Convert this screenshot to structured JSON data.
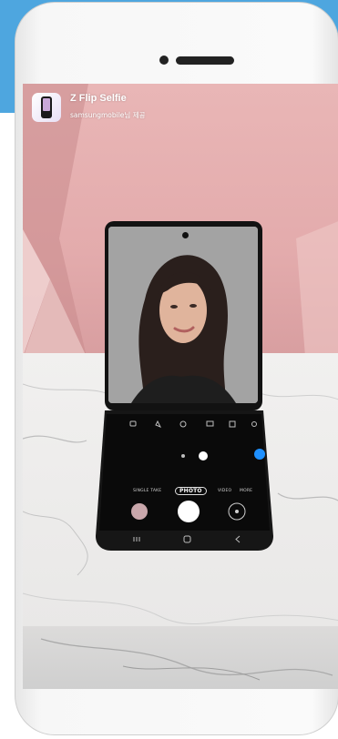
{
  "app": {
    "title": "Z Flip Selfie",
    "subtitle": "samsungmobile님 제공",
    "icon": "app-phone-icon"
  },
  "camera": {
    "modes": [
      "SINGLE TAKE",
      "PHOTO",
      "VIDEO",
      "MORE"
    ],
    "active_mode": "PHOTO"
  },
  "colors": {
    "accent_blue": "#4ea6df",
    "wall_pink": "#e6b0b0",
    "phone_black": "#121212"
  }
}
